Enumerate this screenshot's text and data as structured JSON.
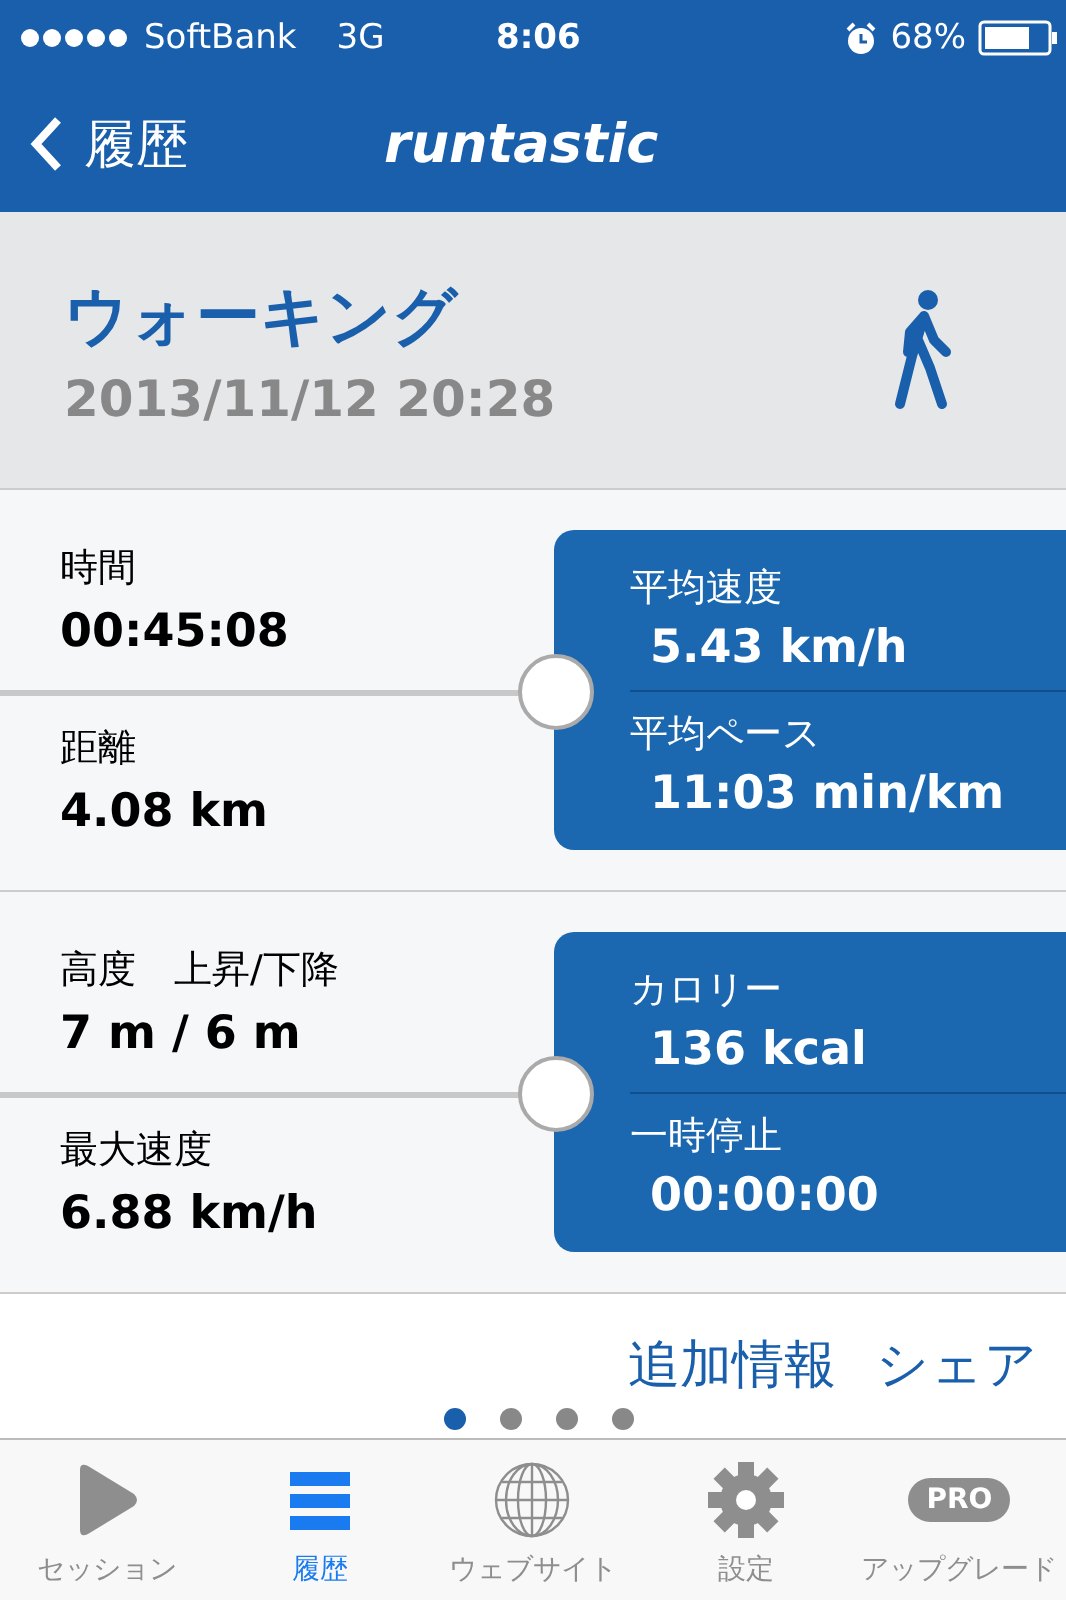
{
  "status_bar": {
    "carrier": "SoftBank",
    "network": "3G",
    "time": "8:06",
    "battery": "68%"
  },
  "nav": {
    "back": "履歴",
    "logo": "runtastic"
  },
  "activity": {
    "title": "ウォーキング",
    "date": "2013/11/12 20:28"
  },
  "panels": [
    {
      "left": [
        {
          "label": "時間",
          "value": "00:45:08"
        },
        {
          "label": "距離",
          "value": "4.08 km"
        }
      ],
      "right": [
        {
          "label": "平均速度",
          "value": "5.43 km/h"
        },
        {
          "label": "平均ペース",
          "value": "11:03 min/km"
        }
      ]
    },
    {
      "left": [
        {
          "label": "高度　上昇/下降",
          "value": "7 m / 6 m"
        },
        {
          "label": "最大速度",
          "value": "6.88 km/h"
        }
      ],
      "right": [
        {
          "label": "カロリー",
          "value": "136 kcal"
        },
        {
          "label": "一時停止",
          "value": "00:00:00"
        }
      ]
    }
  ],
  "links": [
    "追加情報",
    "シェア"
  ],
  "pages": [
    {
      "selected": true
    },
    {
      "selected": false
    },
    {
      "selected": false
    },
    {
      "selected": false
    }
  ],
  "tabs": [
    {
      "kind": "play",
      "label": "セッション",
      "selected": false
    },
    {
      "kind": "list",
      "label": "履歴",
      "selected": true
    },
    {
      "kind": "globe",
      "label": "ウェブサイト",
      "selected": false
    },
    {
      "kind": "gear",
      "label": "設定",
      "selected": false
    },
    {
      "kind": "pro",
      "badge": "PRO",
      "label": "アップグレード",
      "selected": false
    }
  ]
}
